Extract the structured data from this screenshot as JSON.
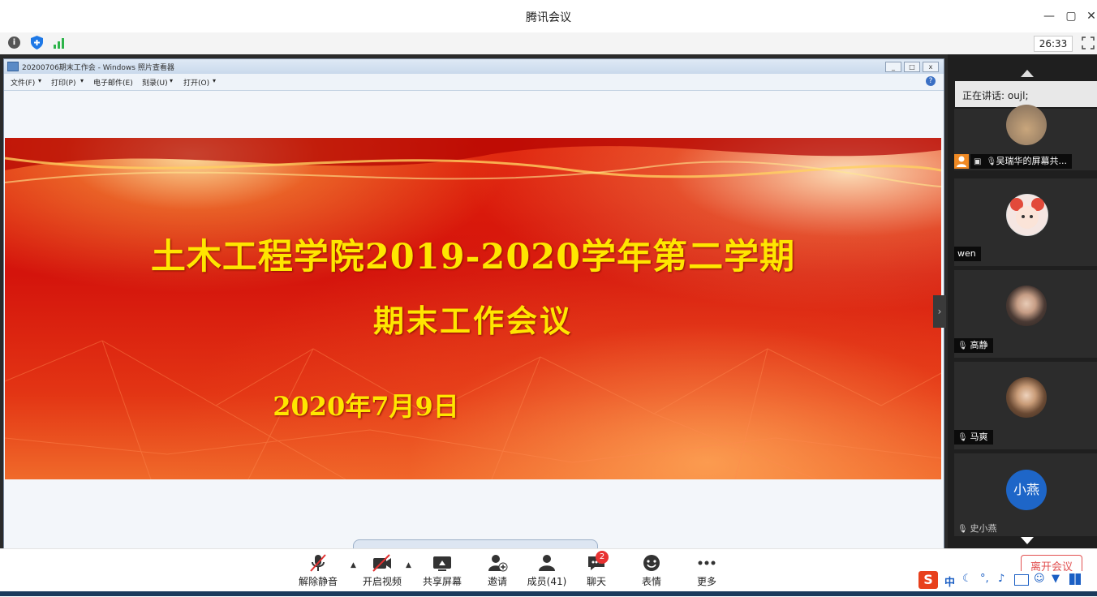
{
  "window": {
    "title": "腾讯会议",
    "minimize": "—",
    "restore": "▢",
    "close": "✕"
  },
  "toolbar": {
    "timer": "26:33",
    "info_icon": "info-icon",
    "shield_icon": "shield-icon",
    "signal_icon": "signal-icon",
    "fullscreen_icon": "fullscreen-icon"
  },
  "viewer": {
    "title": "20200706期末工作会 - Windows 照片查看器",
    "menu": [
      "文件(F)",
      "打印(P)",
      "电子邮件(E)",
      "刻录(U)",
      "打开(O)"
    ]
  },
  "slide": {
    "title1": "土木工程学院2019-2020学年第二学期",
    "title2": "期末工作会议",
    "date": "2020年7月9日"
  },
  "panel": {
    "speaking": "正在讲话: oujl;",
    "participants": [
      {
        "name": "吴瑞华的屏幕共...",
        "avatar_text": "",
        "avatar_color": "#a88a6a"
      },
      {
        "name": "wen",
        "avatar_text": "",
        "avatar_color": "#f3e3de"
      },
      {
        "name": "高静",
        "avatar_text": "",
        "avatar_color": "#6e5a52"
      },
      {
        "name": "马爽",
        "avatar_text": "",
        "avatar_color": "#8a6a4a"
      },
      {
        "name": "史小燕",
        "avatar_text": "小燕",
        "avatar_color": "#1e66c8"
      }
    ]
  },
  "bottombar": {
    "buttons": [
      {
        "label": "解除静音",
        "icon": "mic-muted-icon"
      },
      {
        "label": "开启视频",
        "icon": "video-off-icon"
      },
      {
        "label": "共享屏幕",
        "icon": "share-screen-icon"
      },
      {
        "label": "邀请",
        "icon": "invite-icon"
      },
      {
        "label": "成员(41)",
        "icon": "members-icon"
      },
      {
        "label": "聊天",
        "icon": "chat-icon",
        "badge": "2"
      },
      {
        "label": "表情",
        "icon": "emoji-icon"
      },
      {
        "label": "更多",
        "icon": "more-icon"
      }
    ],
    "leave": "离开会议"
  },
  "ime": {
    "lang": "中"
  }
}
